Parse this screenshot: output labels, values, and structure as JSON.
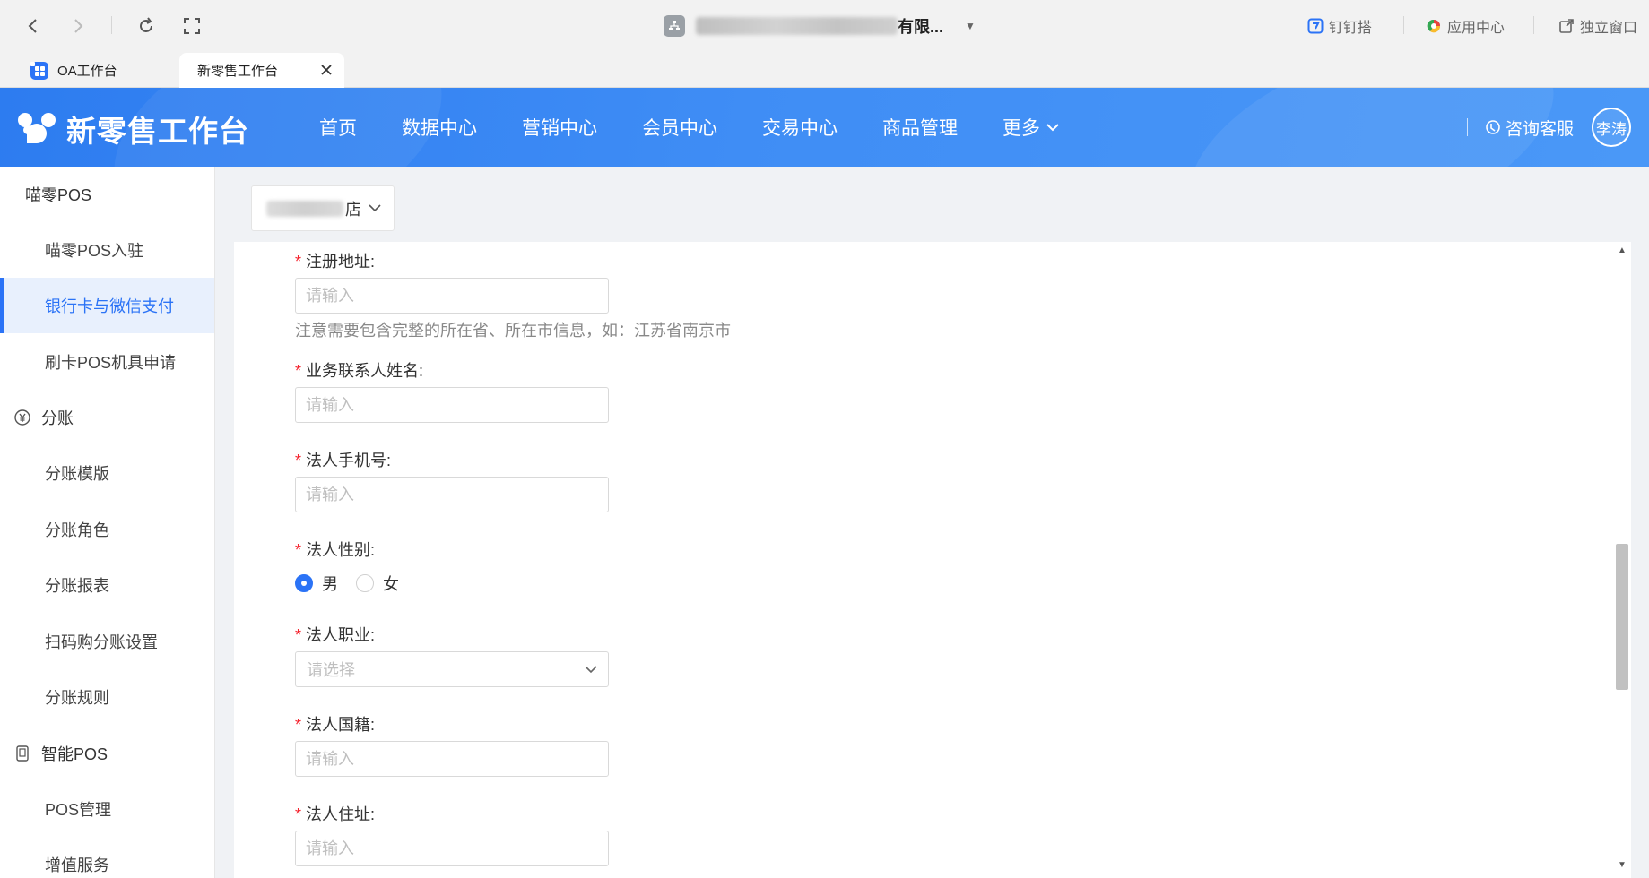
{
  "browser": {
    "address_text": "有限...",
    "tabs": [
      {
        "label": "OA工作台"
      },
      {
        "label": "新零售工作台"
      }
    ],
    "right_actions": [
      {
        "label": "钉钉搭",
        "icon": "dingtalk-icon",
        "color": "#2b73f6"
      },
      {
        "label": "应用中心",
        "icon": "app-center-icon",
        "color": "#e8453c"
      },
      {
        "label": "独立窗口",
        "icon": "external-window-icon",
        "color": "#666666"
      }
    ]
  },
  "header": {
    "title": "新零售工作台",
    "nav": [
      "首页",
      "数据中心",
      "营销中心",
      "会员中心",
      "交易中心",
      "商品管理",
      "更多"
    ],
    "service_label": "咨询客服",
    "user_name": "李涛",
    "brand_color": "#2d7cf0"
  },
  "sidebar": {
    "items": [
      {
        "label": "喵零POS",
        "type": "group"
      },
      {
        "label": "喵零POS入驻",
        "type": "sub"
      },
      {
        "label": "银行卡与微信支付",
        "type": "sub",
        "active": true
      },
      {
        "label": "刷卡POS机具申请",
        "type": "sub"
      },
      {
        "label": "分账",
        "type": "group",
        "icon": "yen-circle-icon"
      },
      {
        "label": "分账模版",
        "type": "sub"
      },
      {
        "label": "分账角色",
        "type": "sub"
      },
      {
        "label": "分账报表",
        "type": "sub"
      },
      {
        "label": "扫码购分账设置",
        "type": "sub"
      },
      {
        "label": "分账规则",
        "type": "sub"
      },
      {
        "label": "智能POS",
        "type": "group",
        "icon": "pos-device-icon"
      },
      {
        "label": "POS管理",
        "type": "sub"
      },
      {
        "label": "增值服务",
        "type": "sub"
      }
    ]
  },
  "store": {
    "label": "店"
  },
  "form": {
    "registered_address": {
      "label": "注册地址:",
      "placeholder": "请输入",
      "hint": "注意需要包含完整的所在省、所在市信息，如：江苏省南京市"
    },
    "contact_name": {
      "label": "业务联系人姓名:",
      "placeholder": "请输入"
    },
    "legal_phone": {
      "label": "法人手机号:",
      "placeholder": "请输入"
    },
    "legal_gender": {
      "label": "法人性别:",
      "options": [
        "男",
        "女"
      ],
      "selected": "男"
    },
    "legal_occupation": {
      "label": "法人职业:",
      "placeholder": "请选择"
    },
    "legal_nationality": {
      "label": "法人国籍:",
      "placeholder": "请输入"
    },
    "legal_residence": {
      "label": "法人住址:",
      "placeholder": "请输入"
    }
  }
}
